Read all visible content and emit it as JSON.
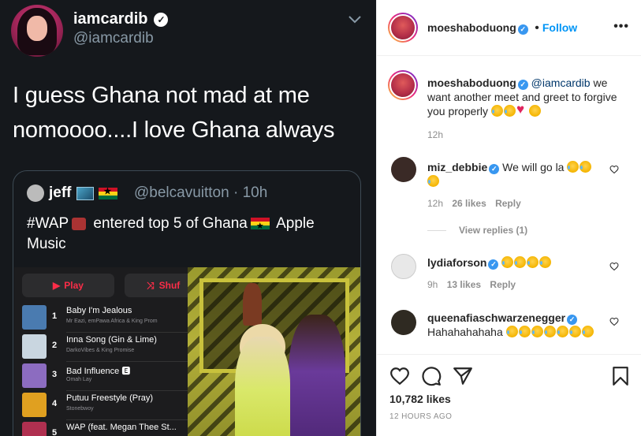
{
  "tweet": {
    "name": "iamcardib",
    "handle": "@iamcardib",
    "text": "I guess Ghana not mad at me nomoooo....I love Ghana always",
    "quote": {
      "name": "jeff",
      "handle": "@belcavuitton · 10h",
      "text_before": "#WAP",
      "text_after": "entered top 5 of Ghana",
      "text_end": "Apple Music",
      "play_label": "Play",
      "shuffle_label": "Shuf",
      "songs": [
        {
          "num": "1",
          "title": "Baby I'm Jealous",
          "artist": "Mr Eazi, emPawa Africa & King Prom",
          "color": "#4a7bb0"
        },
        {
          "num": "2",
          "title": "Inna Song (Gin & Lime)",
          "artist": "DarkoVibes & King Promise",
          "color": "#c9d6e0"
        },
        {
          "num": "3",
          "title": "Bad Influence 🅴",
          "artist": "Omah Lay",
          "color": "#8c6cc0"
        },
        {
          "num": "4",
          "title": "Putuu Freestyle (Pray)",
          "artist": "Stonebwoy",
          "color": "#e0a020"
        },
        {
          "num": "5",
          "title": "WAP (feat. Megan Thee St...",
          "artist": "",
          "color": "#b03050"
        }
      ]
    }
  },
  "post": {
    "author": "moeshaboduong",
    "follow_label": "Follow",
    "caption": {
      "user": "moeshaboduong",
      "mention": "@iamcardib",
      "text": " we want another meet and greet to forgive you properly ",
      "time": "12h"
    },
    "comments": [
      {
        "user": "miz_debbie",
        "text": "We will go la ",
        "time": "12h",
        "likes": "26 likes",
        "reply": "Reply",
        "view_replies": "View replies (1)",
        "avatar_color": "#3a2a26"
      },
      {
        "user": "lydiaforson",
        "text": "",
        "time": "9h",
        "likes": "13 likes",
        "reply": "Reply",
        "avatar_color": "#e8e8e8"
      },
      {
        "user": "queenafiaschwarzenegger",
        "text": "Hahahahahaha ",
        "time": "",
        "likes": "",
        "reply": "",
        "avatar_color": "#2f2a22"
      }
    ],
    "likes": "10,782 likes",
    "time_ago": "12 HOURS AGO"
  }
}
